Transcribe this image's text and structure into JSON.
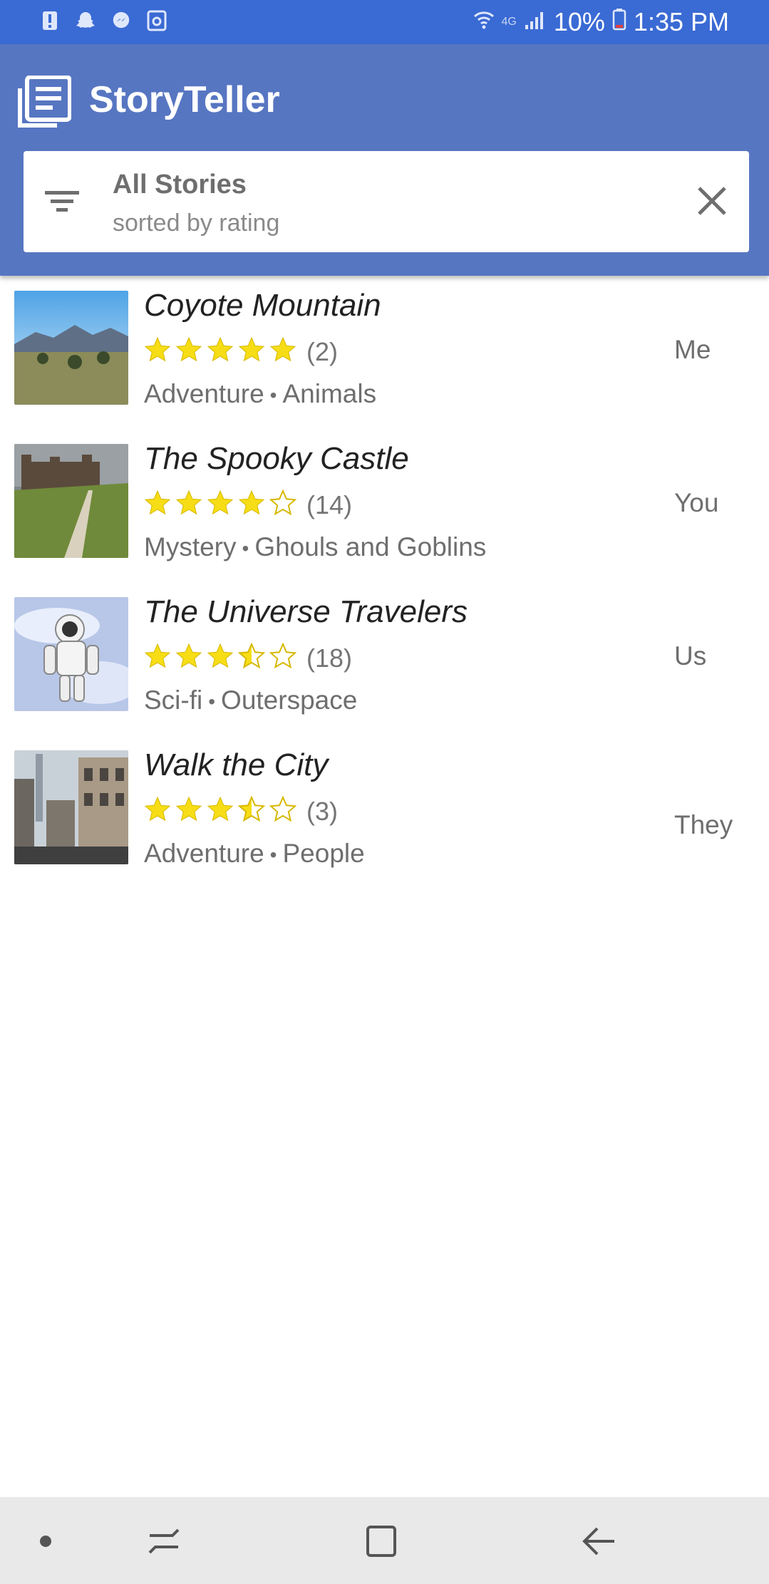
{
  "status_bar": {
    "signal_label": "4G",
    "battery_text": "10%",
    "time": "1:35 PM"
  },
  "app": {
    "title": "StoryTeller",
    "filter": {
      "title": "All Stories",
      "subtitle": "sorted by rating"
    }
  },
  "stories": [
    {
      "title": "Coyote Mountain",
      "rating": 5,
      "count": "(2)",
      "tag1": "Adventure",
      "tag2": "Animals",
      "author": "Me",
      "thumb": "mountain-photo"
    },
    {
      "title": "The Spooky Castle",
      "rating": 4,
      "count": "(14)",
      "tag1": "Mystery",
      "tag2": "Ghouls and Goblins",
      "author": "You",
      "thumb": "castle-photo"
    },
    {
      "title": "The Universe Travelers",
      "rating": 3.5,
      "count": "(18)",
      "tag1": "Sci-fi",
      "tag2": "Outerspace",
      "author": "Us",
      "thumb": "astronaut-photo"
    },
    {
      "title": "Walk the City",
      "rating": 3.5,
      "count": "(3)",
      "tag1": "Adventure",
      "tag2": "People",
      "author": "They",
      "thumb": "city-street-photo"
    }
  ],
  "colors": {
    "statusbar": "#3a6ad4",
    "appbar": "#5776c2",
    "star": "#f6dd15"
  }
}
